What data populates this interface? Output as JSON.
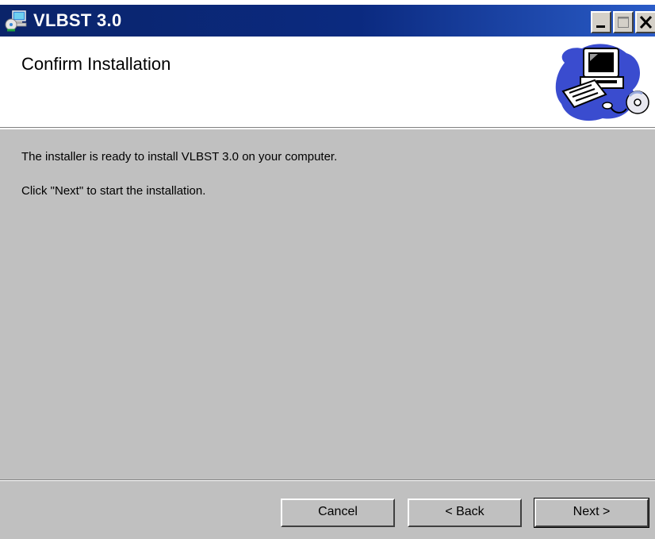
{
  "window": {
    "title": "VLBST 3.0",
    "controls": {
      "minimize": "minimize",
      "maximize": "maximize",
      "close": "close"
    }
  },
  "header": {
    "title": "Confirm Installation",
    "art": "computer-setup-illustration"
  },
  "body": {
    "line1": "The installer is ready to install VLBST 3.0 on your computer.",
    "line2": "Click \"Next\" to start the installation."
  },
  "buttons": {
    "cancel": "Cancel",
    "back": "< Back",
    "next": "Next >"
  },
  "colors": {
    "titlebar": "#0a246a",
    "dialog_bg": "#c0c0c0",
    "header_bg": "#ffffff",
    "art_blue": "#3a4ccf"
  }
}
